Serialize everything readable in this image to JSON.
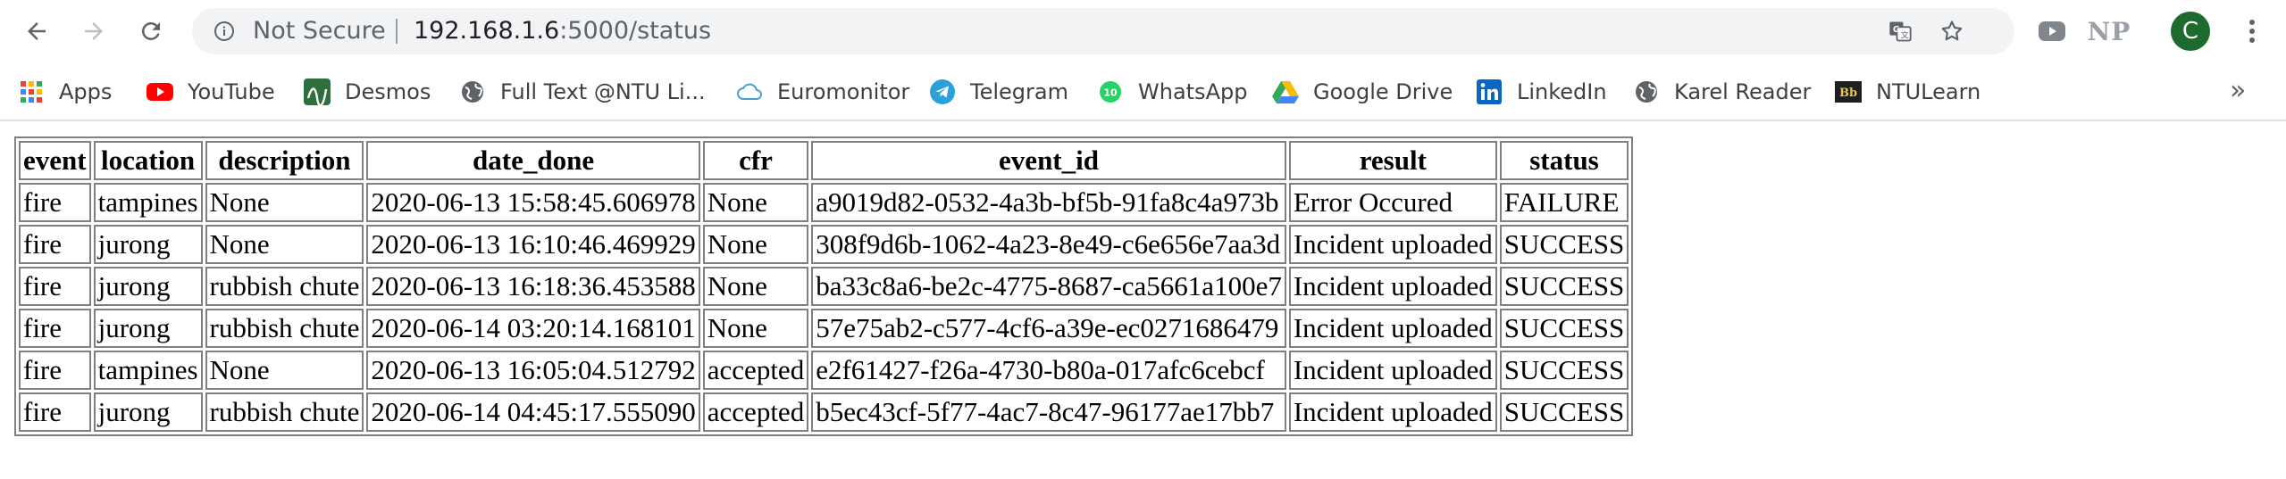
{
  "toolbar": {
    "security_label": "Not Secure",
    "url_host": "192.168.1.6",
    "url_rest": ":5000/status",
    "extension_np_label": "NP",
    "avatar_letter": "C"
  },
  "bookmarks": [
    {
      "label": "Apps",
      "icon": "apps-grid-icon"
    },
    {
      "label": "YouTube",
      "icon": "youtube-icon"
    },
    {
      "label": "Desmos",
      "icon": "desmos-icon"
    },
    {
      "label": "Full Text @NTU Li...",
      "icon": "globe-icon"
    },
    {
      "label": "Euromonitor",
      "icon": "cloud-icon"
    },
    {
      "label": "Telegram",
      "icon": "telegram-icon"
    },
    {
      "label": "WhatsApp",
      "icon": "whatsapp-icon"
    },
    {
      "label": "Google Drive",
      "icon": "google-drive-icon"
    },
    {
      "label": "LinkedIn",
      "icon": "linkedin-icon"
    },
    {
      "label": "Karel Reader",
      "icon": "globe-icon"
    },
    {
      "label": "NTULearn",
      "icon": "blackboard-icon"
    }
  ],
  "bookmarks_more": "»",
  "whatsapp_badge": "10",
  "table": {
    "columns": [
      "event",
      "location",
      "description",
      "date_done",
      "cfr",
      "event_id",
      "result",
      "status"
    ],
    "rows": [
      [
        "fire",
        "tampines",
        "None",
        "2020-06-13 15:58:45.606978",
        "None",
        "a9019d82-0532-4a3b-bf5b-91fa8c4a973b",
        "Error Occured",
        "FAILURE"
      ],
      [
        "fire",
        "jurong",
        "None",
        "2020-06-13 16:10:46.469929",
        "None",
        "308f9d6b-1062-4a23-8e49-c6e656e7aa3d",
        "Incident uploaded",
        "SUCCESS"
      ],
      [
        "fire",
        "jurong",
        "rubbish chute",
        "2020-06-13 16:18:36.453588",
        "None",
        "ba33c8a6-be2c-4775-8687-ca5661a100e7",
        "Incident uploaded",
        "SUCCESS"
      ],
      [
        "fire",
        "jurong",
        "rubbish chute",
        "2020-06-14 03:20:14.168101",
        "None",
        "57e75ab2-c577-4cf6-a39e-ec0271686479",
        "Incident uploaded",
        "SUCCESS"
      ],
      [
        "fire",
        "tampines",
        "None",
        "2020-06-13 16:05:04.512792",
        "accepted",
        "e2f61427-f26a-4730-b80a-017afc6cebcf",
        "Incident uploaded",
        "SUCCESS"
      ],
      [
        "fire",
        "jurong",
        "rubbish chute",
        "2020-06-14 04:45:17.555090",
        "accepted",
        "b5ec43cf-5f77-4ac7-8c47-96177ae17bb7",
        "Incident uploaded",
        "SUCCESS"
      ]
    ]
  }
}
